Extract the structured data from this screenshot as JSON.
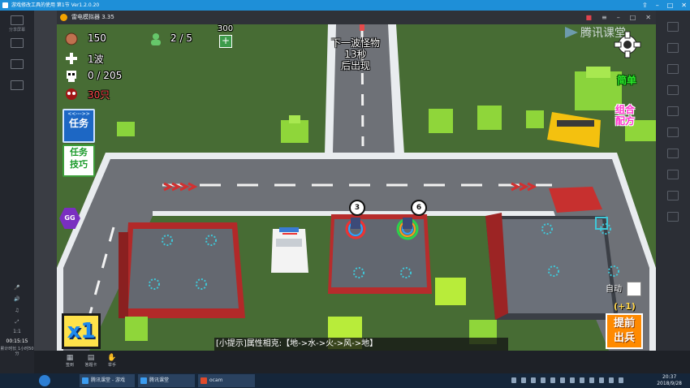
{
  "host": {
    "title": "游戏修改工具的使用 第1节 Ver1.2.0.20",
    "sidebar": [
      "分享屏幕",
      "",
      ""
    ],
    "time": "00:15:15",
    "status": "累计时长 1小时50分",
    "bottom_tools": [
      "签到",
      "答题卡",
      "举手"
    ]
  },
  "emulator": {
    "title": "雷电模拟器 3.35"
  },
  "hud": {
    "coins": "150",
    "units": "2 / 5",
    "units_cost": "300",
    "wave": "1波",
    "kills": "0 / 205",
    "remaining": "30只",
    "next_wave": [
      "下一波怪物",
      "13秒",
      "后出现"
    ],
    "watermark": "腾讯课堂",
    "task_arrows": "<<--->>",
    "task": "任务",
    "tips": [
      "任务",
      "技巧"
    ],
    "gg": "GG",
    "difficulty": "简单",
    "combo": [
      "组合",
      "配方"
    ],
    "auto_label": "自动",
    "plus_one": "(+1)",
    "early": [
      "提前",
      "出兵"
    ],
    "speed": "x1",
    "hint": "[小提示]属性相克:【地->水->火->风->地】",
    "tower_levels": [
      "3",
      "6"
    ]
  },
  "taskbar": {
    "apps": [
      "腾讯课堂 - 游戏",
      "腾讯课堂",
      "ocam"
    ],
    "time": "20:37",
    "date": "2018/9/28"
  },
  "colors": {
    "host_blue": "#1e8fd8",
    "grass": "#476c34",
    "road": "#6e7177",
    "curb": "#e9ecef",
    "accent_orange": "#ff8a00",
    "task_blue": "#1d67c4"
  }
}
